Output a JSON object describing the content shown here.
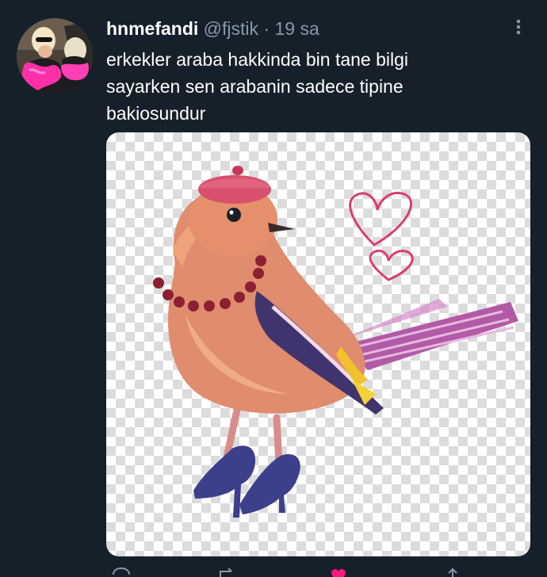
{
  "tweet": {
    "display_name": "hnmefandi",
    "handle": "@fjstik",
    "separator": "·",
    "time": "19 sa",
    "text_lines": [
      "erkekler araba hakkinda bin tane bilgi",
      "sayarken sen arabanin sadece tipine",
      "bakiosundur"
    ]
  },
  "icons": {
    "more": "more-vertical-icon",
    "reply": "reply-icon",
    "retweet": "retweet-icon",
    "like": "heart-icon",
    "share": "share-icon"
  },
  "colors": {
    "background": "#15202b",
    "text_primary": "#ffffff",
    "text_secondary": "#8899a6",
    "like_active": "#f91880"
  }
}
